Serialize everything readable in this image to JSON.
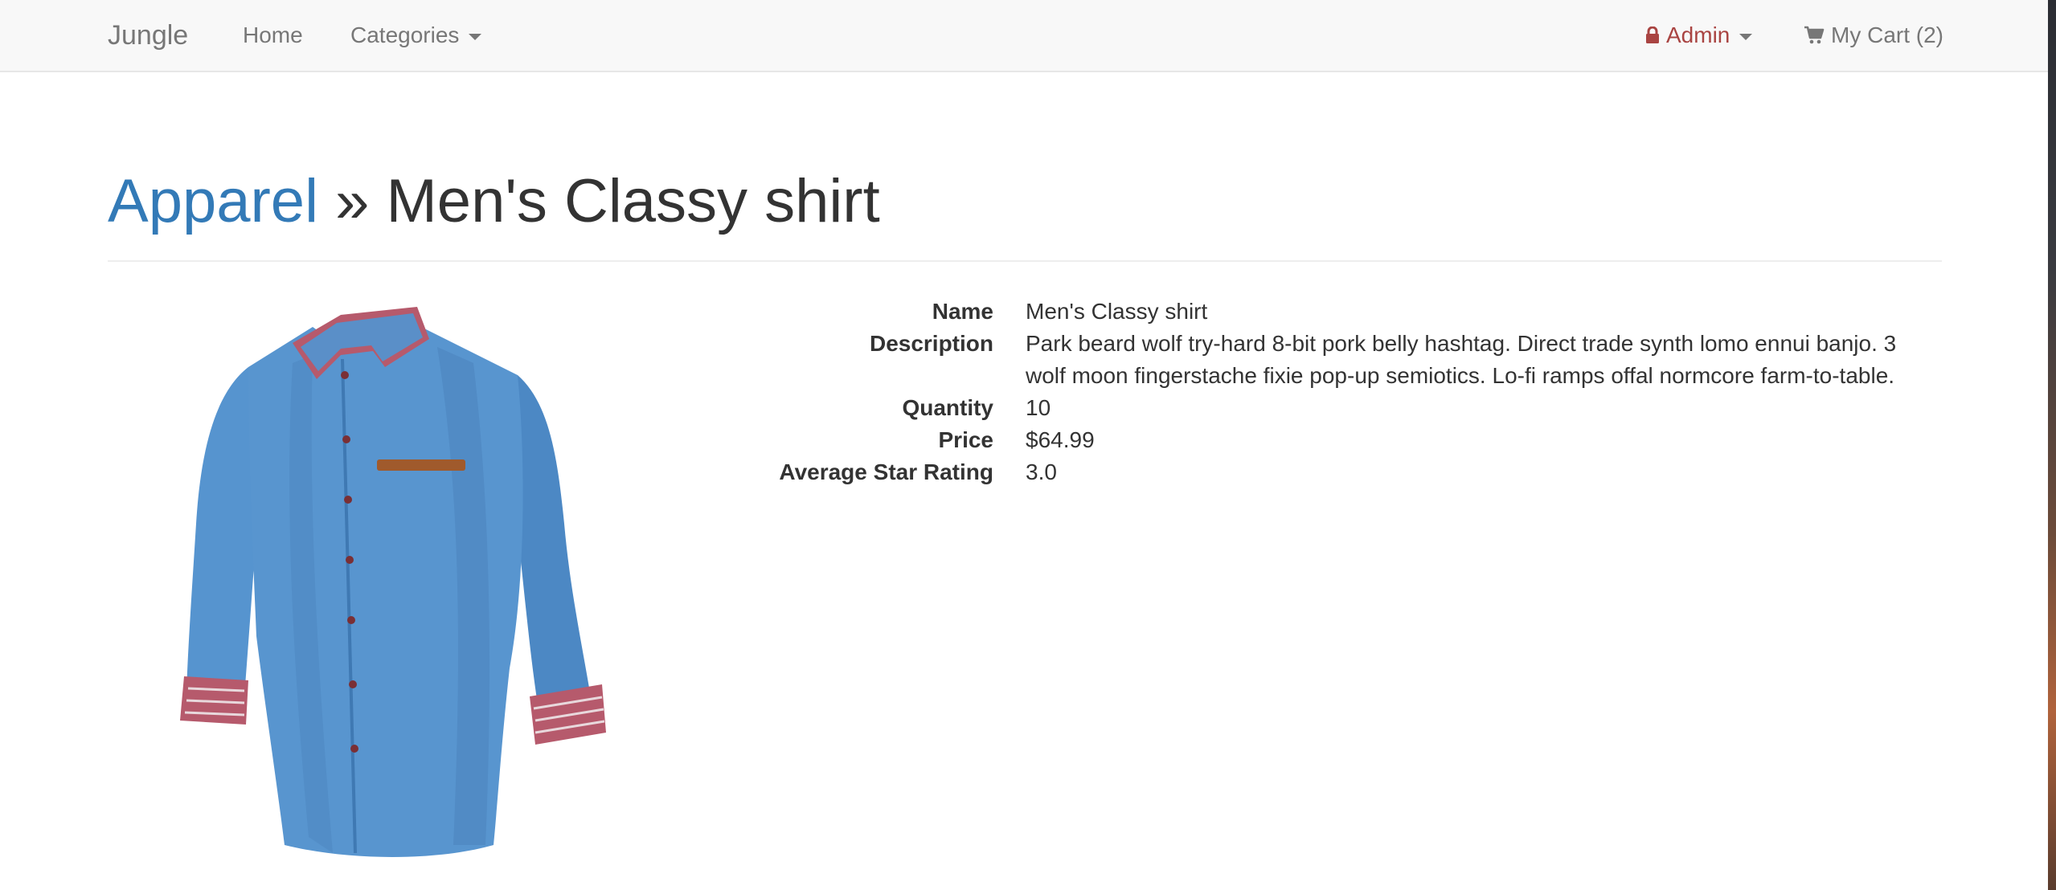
{
  "navbar": {
    "brand": "Jungle",
    "home": "Home",
    "categories": "Categories",
    "admin": "Admin",
    "cart": "My Cart (2)"
  },
  "breadcrumb": {
    "category": "Apparel",
    "separator": "»",
    "product": "Men's Classy shirt"
  },
  "product": {
    "rows": [
      {
        "label": "Name",
        "value": "Men's Classy shirt"
      },
      {
        "label": "Description",
        "value": "Park beard wolf try-hard 8-bit pork belly hashtag. Direct trade synth lomo ennui banjo. 3 wolf moon fingerstache fixie pop-up semiotics. Lo-fi ramps offal normcore farm-to-table."
      },
      {
        "label": "Quantity",
        "value": "10"
      },
      {
        "label": "Price",
        "value": "$64.99"
      },
      {
        "label": "Average Star Rating",
        "value": "3.0"
      }
    ]
  },
  "colors": {
    "link": "#337ab7",
    "admin": "#a94442",
    "navbar_bg": "#f8f8f8",
    "shirt": "#4f8fcb"
  },
  "icons": {
    "admin": "lock-icon",
    "cart": "cart-icon",
    "dropdown": "caret-down-icon"
  }
}
